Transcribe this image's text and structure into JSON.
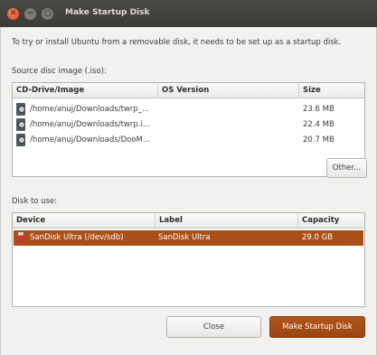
{
  "window": {
    "title": "Make Startup Disk",
    "close_glyph": "✕",
    "min_glyph": "−",
    "max_glyph": "◻"
  },
  "intro": "To try or install Ubuntu from a removable disk, it needs to be set up as a startup disk.",
  "source": {
    "label": "Source disc image (.iso):",
    "columns": [
      "CD-Drive/Image",
      "OS Version",
      "Size"
    ],
    "rows": [
      {
        "image": "/home/anuj/Downloads/twrp_...",
        "os_version": "",
        "size": "23.6 MB",
        "icon": "disc-icon"
      },
      {
        "image": "/home/anuj/Downloads/twrp.i...",
        "os_version": "",
        "size": "22.4 MB",
        "icon": "disc-icon"
      },
      {
        "image": "/home/anuj/Downloads/DooM...",
        "os_version": "",
        "size": "20.7 MB",
        "icon": "disc-icon"
      }
    ],
    "other_button": "Other..."
  },
  "disk": {
    "label": "Disk to use:",
    "columns": [
      "Device",
      "Label",
      "Capacity"
    ],
    "rows": [
      {
        "device": "SanDisk Ultra (/dev/sdb)",
        "label": "SanDisk Ultra",
        "capacity": "29.0 GB",
        "icon": "usb-drive-icon",
        "selected": true
      }
    ]
  },
  "buttons": {
    "close": "Close",
    "make": "Make Startup Disk"
  },
  "colors": {
    "accent": "#a94f17",
    "titlebar": "#3c3b37"
  }
}
